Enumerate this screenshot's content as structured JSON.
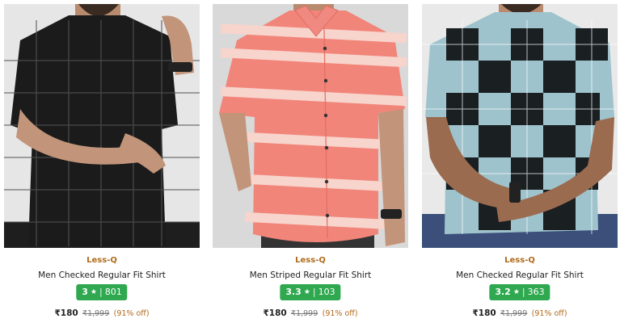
{
  "products": [
    {
      "brand": "Less-Q",
      "title": "Men Checked Regular Fit Shirt",
      "rating": "3",
      "reviews": "801",
      "price": "₹180",
      "mrp": "₹1,999",
      "discount": "(91% off)",
      "image": {
        "shirt_color": "#1b1b1b",
        "pattern": "checked",
        "background": "#e6e6e6"
      }
    },
    {
      "brand": "Less-Q",
      "title": "Men Striped Regular Fit Shirt",
      "rating": "3.3",
      "reviews": "103",
      "price": "₹180",
      "mrp": "₹1,999",
      "discount": "(91% off)",
      "image": {
        "shirt_color": "#f2857a",
        "pattern": "striped",
        "background": "#d9d9d9"
      }
    },
    {
      "brand": "Less-Q",
      "title": "Men Checked Regular Fit Shirt",
      "rating": "3.2",
      "reviews": "363",
      "price": "₹180",
      "mrp": "₹1,999",
      "discount": "(91% off)",
      "image": {
        "shirt_color": "#9fc3cc",
        "pattern": "checked",
        "background": "#e9e9e9"
      }
    }
  ],
  "icons": {
    "star": "star-icon"
  },
  "colors": {
    "rating_badge": "#2fa84f",
    "brand": "#b06a1b",
    "discount": "#b06a1b"
  }
}
